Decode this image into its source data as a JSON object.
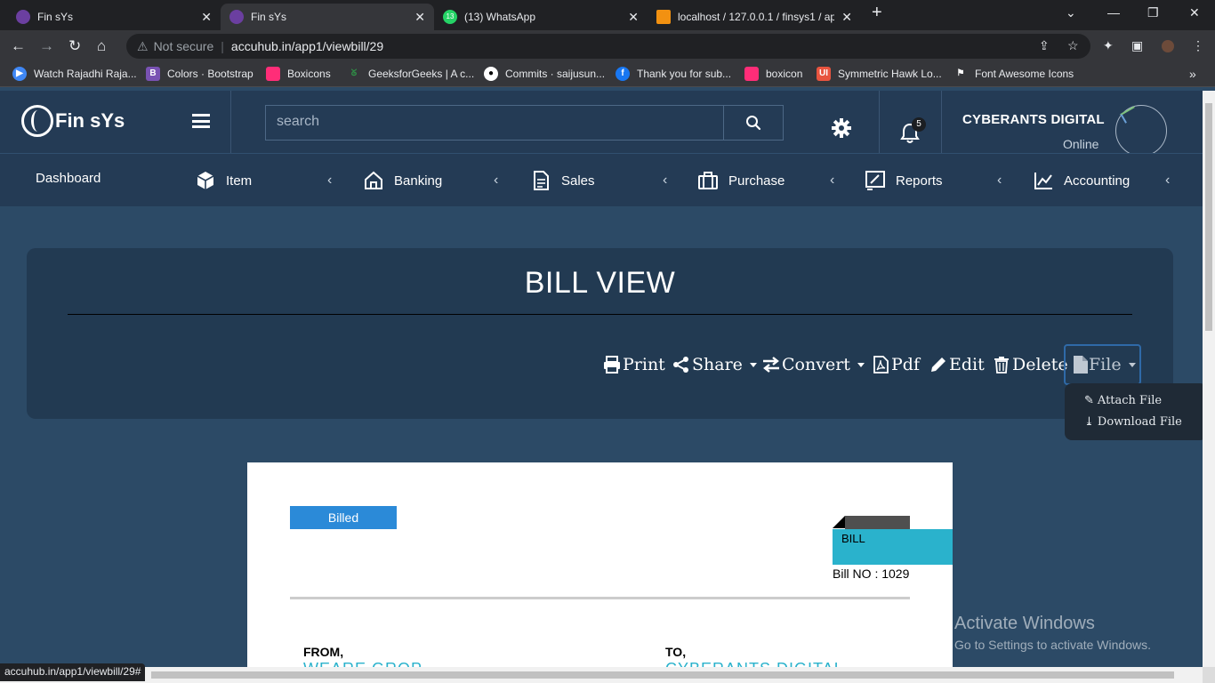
{
  "browser": {
    "tabs": [
      {
        "label": "Fin sYs",
        "active": false
      },
      {
        "label": "Fin sYs",
        "active": true
      },
      {
        "label": "(13) WhatsApp",
        "active": false
      },
      {
        "label": "localhost / 127.0.0.1 / finsys1 / ap",
        "active": false
      }
    ],
    "whatsapp_count": "13",
    "security_label": "Not secure",
    "url": "accuhub.in/app1/viewbill/29",
    "status_url": "accuhub.in/app1/viewbill/29#",
    "bookmarks": [
      {
        "label": "Watch Rajadhi Raja...",
        "icon": "play-icon",
        "color": "#3f87f5"
      },
      {
        "label": "Colors · Bootstrap",
        "icon": "bootstrap-icon",
        "color": "#7952b3"
      },
      {
        "label": "Boxicons",
        "icon": "boxicons-icon",
        "color": "#ff2d78"
      },
      {
        "label": "GeeksforGeeks | A c...",
        "icon": "gfg-icon",
        "color": "#2f8d46"
      },
      {
        "label": "Commits · saijusun...",
        "icon": "github-icon",
        "color": "#ffffff"
      },
      {
        "label": "Thank you for sub...",
        "icon": "facebook-icon",
        "color": "#1877f2"
      },
      {
        "label": "boxicon",
        "icon": "boxicons-icon",
        "color": "#ff2d78"
      },
      {
        "label": "Symmetric Hawk Lo...",
        "icon": "ui-icon",
        "color": "#e8543f"
      },
      {
        "label": "Font Awesome Icons",
        "icon": "flag-icon",
        "color": "#ffffff"
      }
    ]
  },
  "app": {
    "brand": "Fin sYs",
    "search_placeholder": "search",
    "notification_count": "5",
    "company": "CYBERANTS DIGITAL",
    "status": "Online",
    "nav": [
      {
        "label": "Dashboard",
        "icon": ""
      },
      {
        "label": "Item",
        "icon": "cube-icon"
      },
      {
        "label": "Banking",
        "icon": "bank-icon"
      },
      {
        "label": "Sales",
        "icon": "document-icon"
      },
      {
        "label": "Purchase",
        "icon": "briefcase-icon"
      },
      {
        "label": "Reports",
        "icon": "report-icon"
      },
      {
        "label": "Accounting",
        "icon": "chart-icon"
      }
    ]
  },
  "page": {
    "title": "BILL VIEW",
    "actions": {
      "print": "Print",
      "share": "Share",
      "convert": "Convert",
      "pdf": "Pdf",
      "edit": "Edit",
      "delete": "Delete",
      "file": "File"
    },
    "file_menu": {
      "attach": "Attach File",
      "download": "Download File"
    }
  },
  "bill": {
    "status": "Billed",
    "ribbon": "BILL",
    "bill_no": "Bill NO : 1029",
    "from_label": "FROM,",
    "to_label": "TO,",
    "from_name": "WEARE GROP",
    "to_name": "CYBERANTS DIGITAL"
  },
  "watermark": {
    "line1": "Activate Windows",
    "line2": "Go to Settings to activate Windows."
  }
}
